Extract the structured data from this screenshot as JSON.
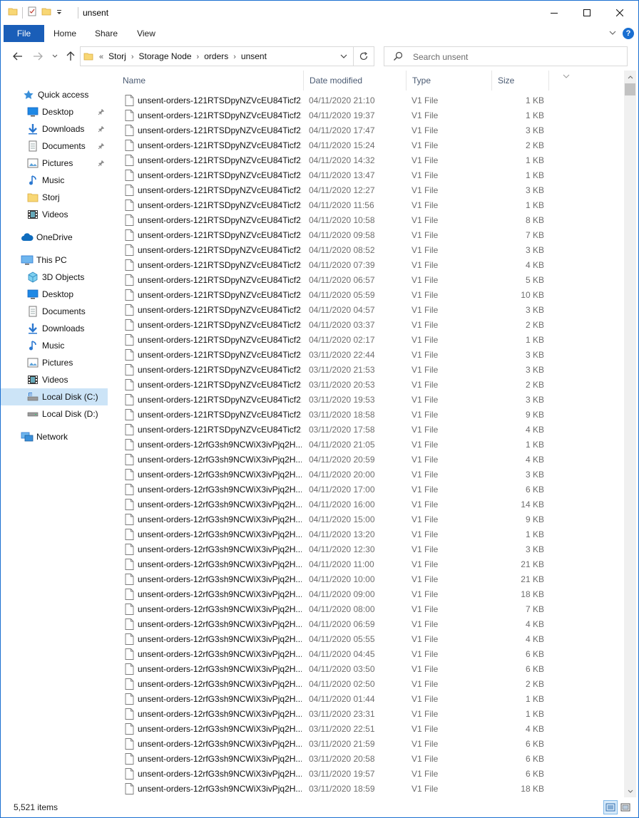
{
  "window": {
    "title": "unsent"
  },
  "ribbon": {
    "tabs": [
      "File",
      "Home",
      "Share",
      "View"
    ]
  },
  "address": {
    "overflow": "«",
    "crumbs": [
      "Storj",
      "Storage Node",
      "orders",
      "unsent"
    ]
  },
  "search": {
    "placeholder": "Search unsent"
  },
  "nav": {
    "items": [
      {
        "label": "Quick access",
        "icon": "star-icon",
        "pinned": false
      },
      {
        "label": "Desktop",
        "icon": "desktop-icon",
        "pinned": true
      },
      {
        "label": "Downloads",
        "icon": "download-icon",
        "pinned": true
      },
      {
        "label": "Documents",
        "icon": "documents-icon",
        "pinned": true
      },
      {
        "label": "Pictures",
        "icon": "pictures-icon",
        "pinned": true
      },
      {
        "label": "Music",
        "icon": "music-icon",
        "pinned": false
      },
      {
        "label": "Storj",
        "icon": "folder-icon",
        "pinned": false
      },
      {
        "label": "Videos",
        "icon": "videos-icon",
        "pinned": false
      },
      {
        "label": "OneDrive",
        "icon": "cloud-icon",
        "pinned": false
      },
      {
        "label": "This PC",
        "icon": "computer-icon",
        "pinned": false
      },
      {
        "label": "3D Objects",
        "icon": "cube-icon",
        "pinned": false
      },
      {
        "label": "Desktop",
        "icon": "desktop-icon",
        "pinned": false
      },
      {
        "label": "Documents",
        "icon": "documents-icon",
        "pinned": false
      },
      {
        "label": "Downloads",
        "icon": "download-icon",
        "pinned": false
      },
      {
        "label": "Music",
        "icon": "music-icon",
        "pinned": false
      },
      {
        "label": "Pictures",
        "icon": "pictures-icon",
        "pinned": false
      },
      {
        "label": "Videos",
        "icon": "videos-icon",
        "pinned": false
      },
      {
        "label": "Local Disk (C:)",
        "icon": "drive-c-icon",
        "pinned": false,
        "selected": true
      },
      {
        "label": "Local Disk (D:)",
        "icon": "drive-icon",
        "pinned": false
      },
      {
        "label": "Network",
        "icon": "network-icon",
        "pinned": false
      }
    ]
  },
  "columns": {
    "name": "Name",
    "date": "Date modified",
    "type": "Type",
    "size": "Size"
  },
  "files": [
    {
      "name": "unsent-orders-121RTSDpyNZVcEU84Ticf2...",
      "date": "04/11/2020 21:10",
      "type": "V1 File",
      "size": "1 KB"
    },
    {
      "name": "unsent-orders-121RTSDpyNZVcEU84Ticf2...",
      "date": "04/11/2020 19:37",
      "type": "V1 File",
      "size": "1 KB"
    },
    {
      "name": "unsent-orders-121RTSDpyNZVcEU84Ticf2...",
      "date": "04/11/2020 17:47",
      "type": "V1 File",
      "size": "3 KB"
    },
    {
      "name": "unsent-orders-121RTSDpyNZVcEU84Ticf2...",
      "date": "04/11/2020 15:24",
      "type": "V1 File",
      "size": "2 KB"
    },
    {
      "name": "unsent-orders-121RTSDpyNZVcEU84Ticf2...",
      "date": "04/11/2020 14:32",
      "type": "V1 File",
      "size": "1 KB"
    },
    {
      "name": "unsent-orders-121RTSDpyNZVcEU84Ticf2...",
      "date": "04/11/2020 13:47",
      "type": "V1 File",
      "size": "1 KB"
    },
    {
      "name": "unsent-orders-121RTSDpyNZVcEU84Ticf2...",
      "date": "04/11/2020 12:27",
      "type": "V1 File",
      "size": "3 KB"
    },
    {
      "name": "unsent-orders-121RTSDpyNZVcEU84Ticf2...",
      "date": "04/11/2020 11:56",
      "type": "V1 File",
      "size": "1 KB"
    },
    {
      "name": "unsent-orders-121RTSDpyNZVcEU84Ticf2...",
      "date": "04/11/2020 10:58",
      "type": "V1 File",
      "size": "8 KB"
    },
    {
      "name": "unsent-orders-121RTSDpyNZVcEU84Ticf2...",
      "date": "04/11/2020 09:58",
      "type": "V1 File",
      "size": "7 KB"
    },
    {
      "name": "unsent-orders-121RTSDpyNZVcEU84Ticf2...",
      "date": "04/11/2020 08:52",
      "type": "V1 File",
      "size": "3 KB"
    },
    {
      "name": "unsent-orders-121RTSDpyNZVcEU84Ticf2...",
      "date": "04/11/2020 07:39",
      "type": "V1 File",
      "size": "4 KB"
    },
    {
      "name": "unsent-orders-121RTSDpyNZVcEU84Ticf2...",
      "date": "04/11/2020 06:57",
      "type": "V1 File",
      "size": "5 KB"
    },
    {
      "name": "unsent-orders-121RTSDpyNZVcEU84Ticf2...",
      "date": "04/11/2020 05:59",
      "type": "V1 File",
      "size": "10 KB"
    },
    {
      "name": "unsent-orders-121RTSDpyNZVcEU84Ticf2...",
      "date": "04/11/2020 04:57",
      "type": "V1 File",
      "size": "3 KB"
    },
    {
      "name": "unsent-orders-121RTSDpyNZVcEU84Ticf2...",
      "date": "04/11/2020 03:37",
      "type": "V1 File",
      "size": "2 KB"
    },
    {
      "name": "unsent-orders-121RTSDpyNZVcEU84Ticf2...",
      "date": "04/11/2020 02:17",
      "type": "V1 File",
      "size": "1 KB"
    },
    {
      "name": "unsent-orders-121RTSDpyNZVcEU84Ticf2...",
      "date": "03/11/2020 22:44",
      "type": "V1 File",
      "size": "3 KB"
    },
    {
      "name": "unsent-orders-121RTSDpyNZVcEU84Ticf2...",
      "date": "03/11/2020 21:53",
      "type": "V1 File",
      "size": "3 KB"
    },
    {
      "name": "unsent-orders-121RTSDpyNZVcEU84Ticf2...",
      "date": "03/11/2020 20:53",
      "type": "V1 File",
      "size": "2 KB"
    },
    {
      "name": "unsent-orders-121RTSDpyNZVcEU84Ticf2...",
      "date": "03/11/2020 19:53",
      "type": "V1 File",
      "size": "3 KB"
    },
    {
      "name": "unsent-orders-121RTSDpyNZVcEU84Ticf2...",
      "date": "03/11/2020 18:58",
      "type": "V1 File",
      "size": "9 KB"
    },
    {
      "name": "unsent-orders-121RTSDpyNZVcEU84Ticf2...",
      "date": "03/11/2020 17:58",
      "type": "V1 File",
      "size": "4 KB"
    },
    {
      "name": "unsent-orders-12rfG3sh9NCWiX3ivPjq2H...",
      "date": "04/11/2020 21:05",
      "type": "V1 File",
      "size": "1 KB"
    },
    {
      "name": "unsent-orders-12rfG3sh9NCWiX3ivPjq2H...",
      "date": "04/11/2020 20:59",
      "type": "V1 File",
      "size": "4 KB"
    },
    {
      "name": "unsent-orders-12rfG3sh9NCWiX3ivPjq2H...",
      "date": "04/11/2020 20:00",
      "type": "V1 File",
      "size": "3 KB"
    },
    {
      "name": "unsent-orders-12rfG3sh9NCWiX3ivPjq2H...",
      "date": "04/11/2020 17:00",
      "type": "V1 File",
      "size": "6 KB"
    },
    {
      "name": "unsent-orders-12rfG3sh9NCWiX3ivPjq2H...",
      "date": "04/11/2020 16:00",
      "type": "V1 File",
      "size": "14 KB"
    },
    {
      "name": "unsent-orders-12rfG3sh9NCWiX3ivPjq2H...",
      "date": "04/11/2020 15:00",
      "type": "V1 File",
      "size": "9 KB"
    },
    {
      "name": "unsent-orders-12rfG3sh9NCWiX3ivPjq2H...",
      "date": "04/11/2020 13:20",
      "type": "V1 File",
      "size": "1 KB"
    },
    {
      "name": "unsent-orders-12rfG3sh9NCWiX3ivPjq2H...",
      "date": "04/11/2020 12:30",
      "type": "V1 File",
      "size": "3 KB"
    },
    {
      "name": "unsent-orders-12rfG3sh9NCWiX3ivPjq2H...",
      "date": "04/11/2020 11:00",
      "type": "V1 File",
      "size": "21 KB"
    },
    {
      "name": "unsent-orders-12rfG3sh9NCWiX3ivPjq2H...",
      "date": "04/11/2020 10:00",
      "type": "V1 File",
      "size": "21 KB"
    },
    {
      "name": "unsent-orders-12rfG3sh9NCWiX3ivPjq2H...",
      "date": "04/11/2020 09:00",
      "type": "V1 File",
      "size": "18 KB"
    },
    {
      "name": "unsent-orders-12rfG3sh9NCWiX3ivPjq2H...",
      "date": "04/11/2020 08:00",
      "type": "V1 File",
      "size": "7 KB"
    },
    {
      "name": "unsent-orders-12rfG3sh9NCWiX3ivPjq2H...",
      "date": "04/11/2020 06:59",
      "type": "V1 File",
      "size": "4 KB"
    },
    {
      "name": "unsent-orders-12rfG3sh9NCWiX3ivPjq2H...",
      "date": "04/11/2020 05:55",
      "type": "V1 File",
      "size": "4 KB"
    },
    {
      "name": "unsent-orders-12rfG3sh9NCWiX3ivPjq2H...",
      "date": "04/11/2020 04:45",
      "type": "V1 File",
      "size": "6 KB"
    },
    {
      "name": "unsent-orders-12rfG3sh9NCWiX3ivPjq2H...",
      "date": "04/11/2020 03:50",
      "type": "V1 File",
      "size": "6 KB"
    },
    {
      "name": "unsent-orders-12rfG3sh9NCWiX3ivPjq2H...",
      "date": "04/11/2020 02:50",
      "type": "V1 File",
      "size": "2 KB"
    },
    {
      "name": "unsent-orders-12rfG3sh9NCWiX3ivPjq2H...",
      "date": "04/11/2020 01:44",
      "type": "V1 File",
      "size": "1 KB"
    },
    {
      "name": "unsent-orders-12rfG3sh9NCWiX3ivPjq2H...",
      "date": "03/11/2020 23:31",
      "type": "V1 File",
      "size": "1 KB"
    },
    {
      "name": "unsent-orders-12rfG3sh9NCWiX3ivPjq2H...",
      "date": "03/11/2020 22:51",
      "type": "V1 File",
      "size": "4 KB"
    },
    {
      "name": "unsent-orders-12rfG3sh9NCWiX3ivPjq2H...",
      "date": "03/11/2020 21:59",
      "type": "V1 File",
      "size": "6 KB"
    },
    {
      "name": "unsent-orders-12rfG3sh9NCWiX3ivPjq2H...",
      "date": "03/11/2020 20:58",
      "type": "V1 File",
      "size": "6 KB"
    },
    {
      "name": "unsent-orders-12rfG3sh9NCWiX3ivPjq2H...",
      "date": "03/11/2020 19:57",
      "type": "V1 File",
      "size": "6 KB"
    },
    {
      "name": "unsent-orders-12rfG3sh9NCWiX3ivPjq2H...",
      "date": "03/11/2020 18:59",
      "type": "V1 File",
      "size": "18 KB"
    }
  ],
  "status": {
    "count": "5,521 items"
  },
  "colors": {
    "accent": "#1a5eb8",
    "selected": "#cce4f7",
    "folder": "#f8d775"
  }
}
